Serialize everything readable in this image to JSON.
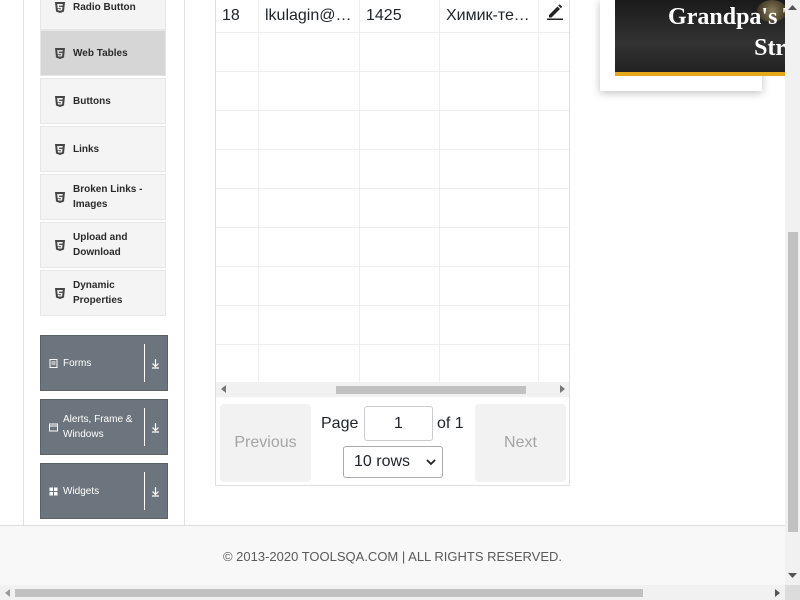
{
  "sidebar": {
    "elements_items": [
      {
        "label": "Radio Button",
        "icon": "html5-icon",
        "active": false
      },
      {
        "label": "Web Tables",
        "icon": "html5-icon",
        "active": true
      },
      {
        "label": "Buttons",
        "icon": "html5-icon",
        "active": false
      },
      {
        "label": "Links",
        "icon": "html5-icon",
        "active": false
      },
      {
        "label": "Broken Links - Images",
        "icon": "html5-icon",
        "active": false
      },
      {
        "label": "Upload and Download",
        "icon": "html5-icon",
        "active": false
      },
      {
        "label": "Dynamic Properties",
        "icon": "html5-icon",
        "active": false
      }
    ],
    "groups": [
      {
        "label": "Forms",
        "icon": "document-icon"
      },
      {
        "label": "Alerts, Frame & Windows",
        "icon": "window-icon"
      },
      {
        "label": "Widgets",
        "icon": "grid-icon"
      }
    ]
  },
  "table": {
    "rows": [
      {
        "age": "18",
        "email": "lkulagin@mail.ru",
        "salary": "1425",
        "department": "Химик-технолог"
      }
    ],
    "pagination": {
      "previous_label": "Previous",
      "next_label": "Next",
      "page_label": "Page",
      "page_value": "1",
      "of_label": "of 1",
      "rows_option": "10 rows"
    }
  },
  "ad": {
    "headline_line1": "Grandpa's The",
    "headline_line2": "Strong",
    "accent_color": "#e6a817"
  },
  "footer": {
    "text": "© 2013-2020 TOOLSQA.COM | ALL RIGHTS RESERVED."
  }
}
